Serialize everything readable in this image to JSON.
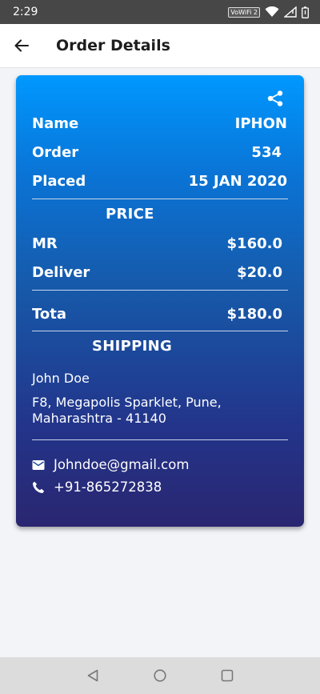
{
  "status": {
    "time": "2:29",
    "wifi_label": "VoWiFi 2"
  },
  "appbar": {
    "title": "Order Details"
  },
  "order": {
    "name_label": "Name",
    "name_value": "IPHON",
    "order_label": "Order",
    "order_value": "534",
    "placed_label": "Placed",
    "placed_value": "15 JAN 2020"
  },
  "price": {
    "title": "PRICE",
    "mrp_label": "MR",
    "mrp_value": "$160.0",
    "delivery_label": "Deliver",
    "delivery_value": "$20.0",
    "total_label": "Tota",
    "total_value": "$180.0"
  },
  "shipping": {
    "title": "SHIPPING",
    "name": "John Doe",
    "address_line1": "F8, Megapolis Sparklet, Pune,",
    "address_line2": "Maharashtra - 41140",
    "email": "Johndoe@gmail.com",
    "phone": "+91-865272838"
  },
  "icons": {
    "back": "arrow-left",
    "share": "share",
    "email": "envelope",
    "phone": "phone",
    "nav_back": "triangle-back",
    "nav_home": "circle-home",
    "nav_recents": "square-recents"
  },
  "colors": {
    "card_top": "#0098ff",
    "card_bottom": "#2a2670",
    "statusbar": "#474747"
  }
}
